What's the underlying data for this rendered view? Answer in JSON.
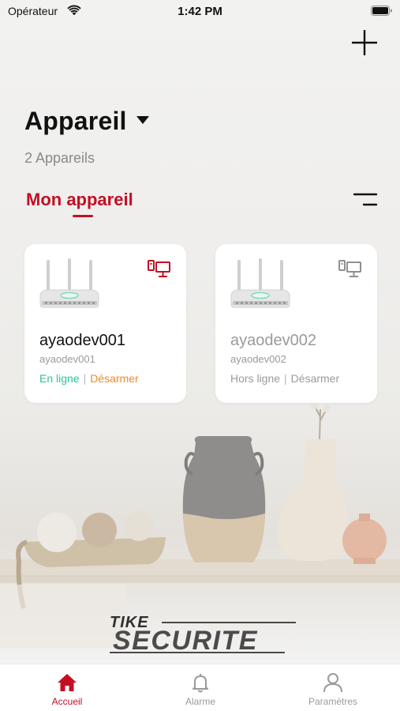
{
  "status_bar": {
    "carrier": "Opérateur",
    "time": "1:42 PM",
    "icons": [
      "wifi-icon",
      "battery-icon"
    ]
  },
  "header": {
    "add_icon": "plus-icon",
    "title": "Appareil",
    "title_caret_icon": "caret-down-icon",
    "device_count": "2 Appareils"
  },
  "tabs": {
    "active": "Mon appareil",
    "filter_icon": "filter-lines-icon"
  },
  "devices": [
    {
      "name": "ayaodev001",
      "subtitle": "ayaodev001",
      "status": "En ligne",
      "arm_state": "Désarmer",
      "online": true
    },
    {
      "name": "ayaodev002",
      "subtitle": "ayaodev002",
      "status": "Hors ligne",
      "arm_state": "Désarmer",
      "online": false
    }
  ],
  "brand": {
    "logo_text": "TIKE SECURITE"
  },
  "bottom_nav": {
    "items": [
      {
        "label": "Accueil",
        "icon": "home-icon",
        "active": true
      },
      {
        "label": "Alarme",
        "icon": "bell-icon",
        "active": false
      },
      {
        "label": "Paramètres",
        "icon": "user-icon",
        "active": false
      }
    ]
  },
  "colors": {
    "accent": "#c40e24",
    "online": "#27c59a",
    "disarm": "#f08a29",
    "muted": "#9a9a9a"
  }
}
